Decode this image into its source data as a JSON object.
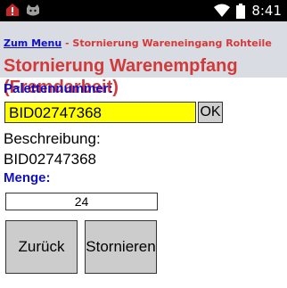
{
  "status_bar": {
    "time": "8:41",
    "left_icons": [
      "alert-icon",
      "cat-icon"
    ],
    "right_icons": [
      "wifi-icon",
      "battery-icon"
    ]
  },
  "header": {
    "breadcrumb_link": "Zum Menu",
    "breadcrumb_separator": " - ",
    "breadcrumb_current": "Stornierung Wareneingang Rohteile",
    "title": "Stornierung Warenempfang (Fremdarbeit)"
  },
  "form": {
    "pallet_label": "Palettennummer:",
    "pallet_value": "BID02747368",
    "ok_label": "OK",
    "description_label": "Beschreibung:",
    "description_value": "BID02747368",
    "quantity_label": "Menge:",
    "quantity_value": "24"
  },
  "buttons": {
    "back": "Zurück",
    "cancel": "Stornieren"
  },
  "colors": {
    "title_red": "#d23a3a",
    "label_blue": "#1010c0",
    "input_yellow": "#ffff00",
    "header_bg": "#d9dce3"
  }
}
